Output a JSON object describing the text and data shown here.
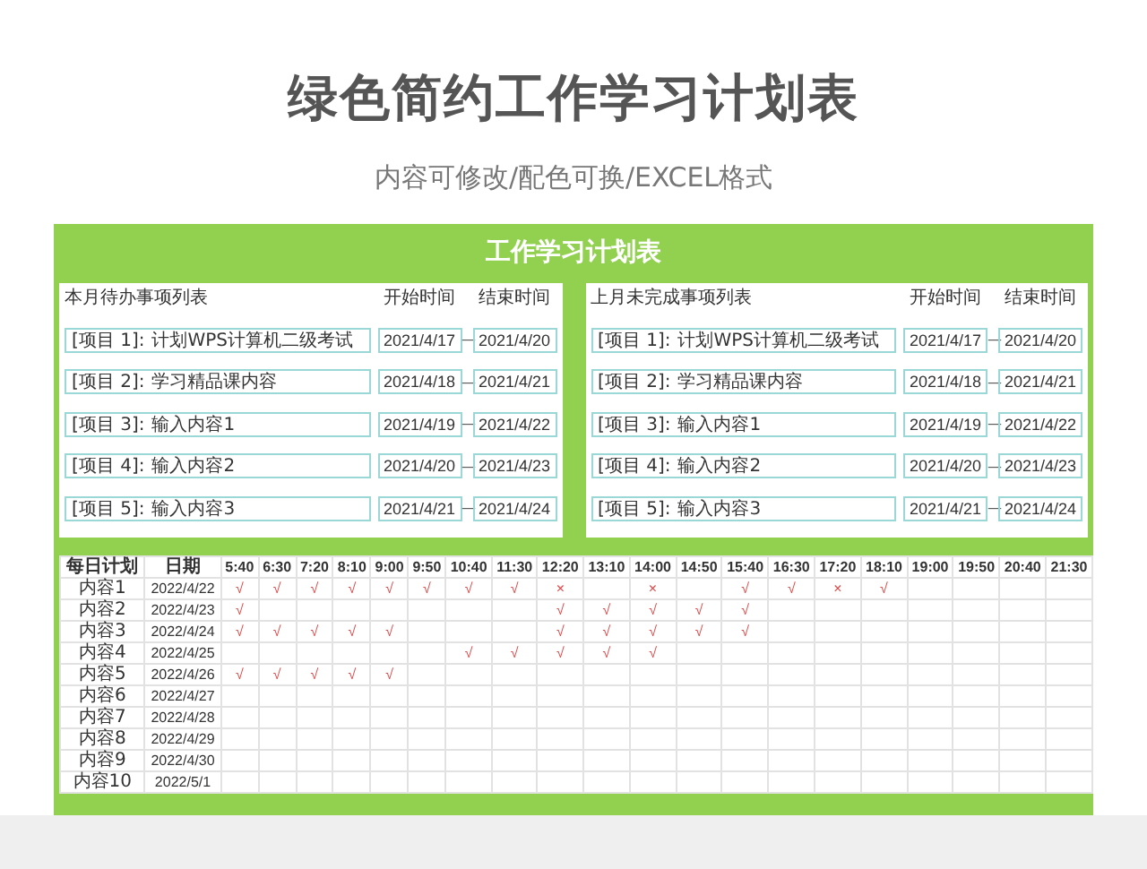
{
  "page": {
    "title": "绿色简约工作学习计划表",
    "subtitle": "内容可修改/配色可换/EXCEL格式"
  },
  "sheet": {
    "title": "工作学习计划表",
    "panels": [
      {
        "heading": "本月待办事项列表",
        "start_heading": "开始时间",
        "end_heading": "结束时间",
        "items": [
          {
            "label": "[项目 1]:",
            "content": "计划WPS计算机二级考试",
            "start": "2021/4/17",
            "separator": "—",
            "end": "2021/4/20"
          },
          {
            "label": "[项目 2]:",
            "content": "学习精品课内容",
            "start": "2021/4/18",
            "separator": "—",
            "end": "2021/4/21"
          },
          {
            "label": "[项目 3]:",
            "content": "输入内容1",
            "start": "2021/4/19",
            "separator": "—",
            "end": "2021/4/22"
          },
          {
            "label": "[项目 4]:",
            "content": "输入内容2",
            "start": "2021/4/20",
            "separator": "—",
            "end": "2021/4/23"
          },
          {
            "label": "[项目 5]:",
            "content": "输入内容3",
            "start": "2021/4/21",
            "separator": "—",
            "end": "2021/4/24"
          }
        ]
      },
      {
        "heading": "上月未完成事项列表",
        "start_heading": "开始时间",
        "end_heading": "结束时间",
        "items": [
          {
            "label": "[项目 1]:",
            "content": "计划WPS计算机二级考试",
            "start": "2021/4/17",
            "separator": "—",
            "end": "2021/4/20"
          },
          {
            "label": "[项目 2]:",
            "content": "学习精品课内容",
            "start": "2021/4/18",
            "separator": "—",
            "end": "2021/4/21"
          },
          {
            "label": "[项目 3]:",
            "content": "输入内容1",
            "start": "2021/4/19",
            "separator": "—",
            "end": "2021/4/22"
          },
          {
            "label": "[项目 4]:",
            "content": "输入内容2",
            "start": "2021/4/20",
            "separator": "—",
            "end": "2021/4/23"
          },
          {
            "label": "[项目 5]:",
            "content": "输入内容3",
            "start": "2021/4/21",
            "separator": "—",
            "end": "2021/4/24"
          }
        ]
      }
    ],
    "schedule": {
      "plan_heading": "每日计划",
      "date_heading": "日期",
      "times": [
        "5:40",
        "6:30",
        "7:20",
        "8:10",
        "9:00",
        "9:50",
        "10:40",
        "11:30",
        "12:20",
        "13:10",
        "14:00",
        "14:50",
        "15:40",
        "16:30",
        "17:20",
        "18:10",
        "19:00",
        "19:50",
        "20:40",
        "21:30"
      ],
      "rows": [
        {
          "plan": "内容1",
          "date": "2022/4/22",
          "cells": [
            "√",
            "√",
            "√",
            "√",
            "√",
            "√",
            "√",
            "√",
            "×",
            null,
            "×",
            null,
            "√",
            "√",
            "×",
            "√",
            null,
            null,
            null,
            null
          ]
        },
        {
          "plan": "内容2",
          "date": "2022/4/23",
          "cells": [
            "√",
            null,
            null,
            null,
            null,
            null,
            null,
            null,
            "√",
            "√",
            "√",
            "√",
            "√",
            null,
            null,
            null,
            null,
            null,
            null,
            null
          ]
        },
        {
          "plan": "内容3",
          "date": "2022/4/24",
          "cells": [
            "√",
            "√",
            "√",
            "√",
            "√",
            null,
            null,
            null,
            "√",
            "√",
            "√",
            "√",
            "√",
            null,
            null,
            null,
            null,
            null,
            null,
            null
          ]
        },
        {
          "plan": "内容4",
          "date": "2022/4/25",
          "cells": [
            null,
            null,
            null,
            null,
            null,
            null,
            "√",
            "√",
            "√",
            "√",
            "√",
            null,
            null,
            null,
            null,
            null,
            null,
            null,
            null,
            null
          ]
        },
        {
          "plan": "内容5",
          "date": "2022/4/26",
          "cells": [
            "√",
            "√",
            "√",
            "√",
            "√",
            null,
            null,
            null,
            null,
            null,
            null,
            null,
            null,
            null,
            null,
            null,
            null,
            null,
            null,
            null
          ]
        },
        {
          "plan": "内容6",
          "date": "2022/4/27",
          "cells": []
        },
        {
          "plan": "内容7",
          "date": "2022/4/28",
          "cells": []
        },
        {
          "plan": "内容8",
          "date": "2022/4/29",
          "cells": []
        },
        {
          "plan": "内容9",
          "date": "2022/4/30",
          "cells": []
        },
        {
          "plan": "内容10",
          "date": "2022/5/1",
          "cells": []
        }
      ]
    }
  }
}
